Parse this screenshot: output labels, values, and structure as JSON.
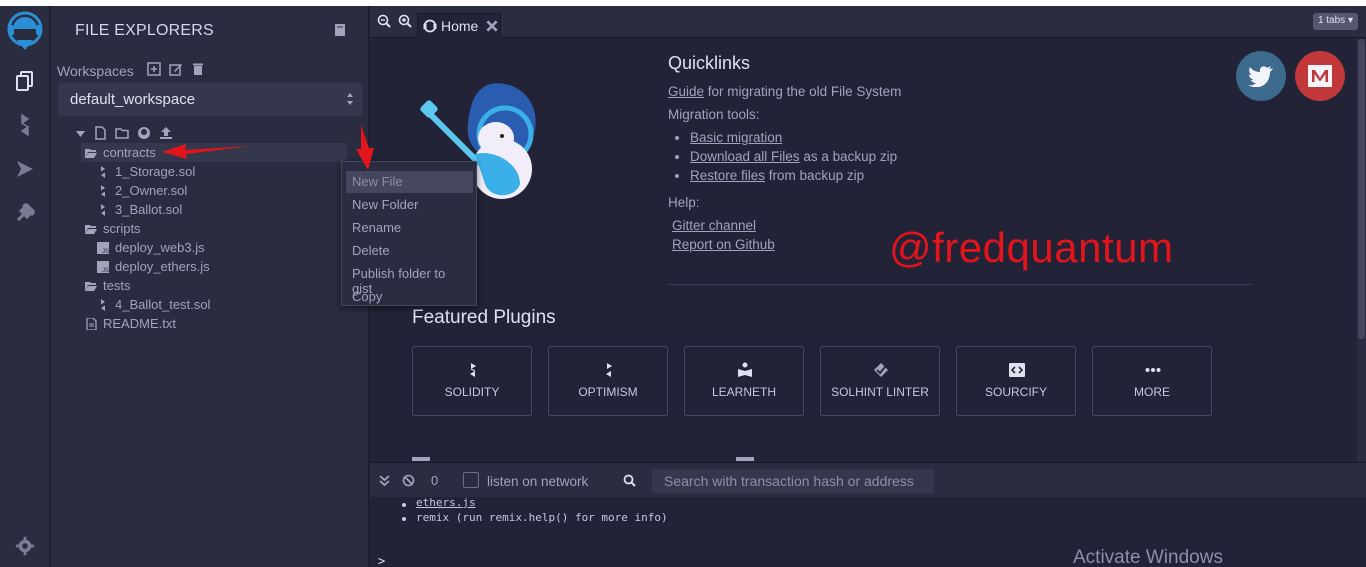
{
  "colors": {
    "accent_red": "#e3141b",
    "twitter_blue": "#3c6b8d",
    "medium_red": "#c0383a",
    "panel": "#2a2c3f",
    "main": "#222336"
  },
  "sidebar": {
    "title": "FILE EXPLORERS",
    "workspaces_label": "Workspaces",
    "workspace_value": "default_workspace",
    "tree": [
      {
        "label": "contracts",
        "kind": "folder",
        "depth": 0,
        "selected": true
      },
      {
        "label": "1_Storage.sol",
        "kind": "sol",
        "depth": 1
      },
      {
        "label": "2_Owner.sol",
        "kind": "sol",
        "depth": 1
      },
      {
        "label": "3_Ballot.sol",
        "kind": "sol",
        "depth": 1
      },
      {
        "label": "scripts",
        "kind": "folder",
        "depth": 0
      },
      {
        "label": "deploy_web3.js",
        "kind": "js",
        "depth": 1
      },
      {
        "label": "deploy_ethers.js",
        "kind": "js",
        "depth": 1
      },
      {
        "label": "tests",
        "kind": "folder",
        "depth": 0
      },
      {
        "label": "4_Ballot_test.sol",
        "kind": "sol",
        "depth": 1
      },
      {
        "label": "README.txt",
        "kind": "txt",
        "depth": 0
      }
    ]
  },
  "context_menu": [
    "New File",
    "New Folder",
    "Rename",
    "Delete",
    "Publish folder to gist",
    "Copy"
  ],
  "tabs": {
    "home_label": "Home",
    "count_label": "1 tabs"
  },
  "home": {
    "quicklinks_title": "Quicklinks",
    "guide_link": "Guide",
    "guide_rest": "for migrating the old File System",
    "migration_label": "Migration tools:",
    "basic_migration": "Basic migration",
    "download_link": "Download all Files",
    "download_rest": "as a backup zip",
    "restore_link": "Restore files",
    "restore_rest": "from backup zip",
    "help_label": "Help:",
    "gitter": "Gitter channel",
    "github": "Report on Github",
    "watermark": "@fredquantum",
    "featured_title": "Featured Plugins",
    "plugins": [
      "SOLIDITY",
      "OPTIMISM",
      "LEARNETH",
      "SOLHINT LINTER",
      "SOURCIFY",
      "MORE"
    ]
  },
  "terminal": {
    "count": "0",
    "listen_label": "listen on network",
    "search_placeholder": "Search with transaction hash or address",
    "line1": "ethers.js",
    "line2": "remix (run remix.help() for more info)",
    "prompt": ">"
  },
  "os_overlay": "Activate Windows"
}
